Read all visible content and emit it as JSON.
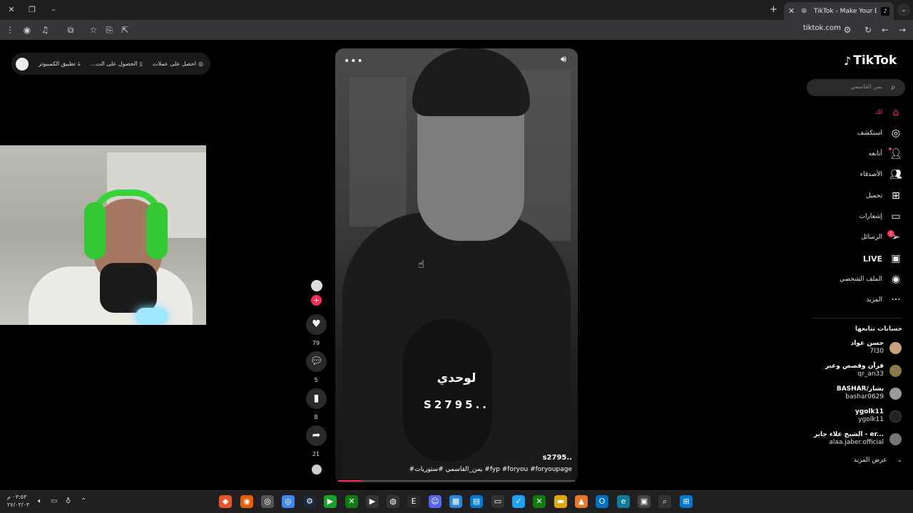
{
  "browser": {
    "tab_title": "TikTok - Make Your Day",
    "address": "tiktok.com"
  },
  "top_bar": {
    "get_coins": "احصل على عملات",
    "get_app": "الحصول على الت...",
    "desktop_app": "تطبيق الكمبيوتر"
  },
  "video": {
    "caption_line1": "لوحدي",
    "caption_line2": "S2795..",
    "author": "s2795..",
    "tags": "#يمن_القاسمي #ستوريات #fyp #foryou #foryoupage",
    "progress": 0.1
  },
  "actions": {
    "likes": "79",
    "comments": "5",
    "saves": "8",
    "shares": "21"
  },
  "sidebar": {
    "logo": "TikTok",
    "search_placeholder": "يمن القاسمي",
    "nav": [
      {
        "label": "لك",
        "icon": "home-icon"
      },
      {
        "label": "استكشف",
        "icon": "compass-icon"
      },
      {
        "label": "أتابعه",
        "icon": "following-icon"
      },
      {
        "label": "الأصدقاء",
        "icon": "friends-icon"
      },
      {
        "label": "تحميل",
        "icon": "upload-icon"
      },
      {
        "label": "إشعارات",
        "icon": "notification-icon"
      },
      {
        "label": "الرسائل",
        "icon": "message-icon"
      },
      {
        "label": "LIVE",
        "icon": "live-icon"
      },
      {
        "label": "الملف الشخصي",
        "icon": "profile-icon"
      },
      {
        "label": "المزيد",
        "icon": "more-icon"
      }
    ],
    "messages_badge": "1",
    "following_title": "حسابات تتابعها",
    "accounts": [
      {
        "name": "حسن عواد",
        "handle": "7l30",
        "color": "#c9a27a"
      },
      {
        "name": "قرآن وقصص وعبر",
        "handle": "qr_an33",
        "color": "#8a7a4a"
      },
      {
        "name": "BASHAR/بشار",
        "handle": "bashar0629",
        "color": "#9a9a9a"
      },
      {
        "name": "ygolk11",
        "handle": "ygolk11",
        "color": "#222222"
      },
      {
        "name": "الشيخ علاء جابر - er...",
        "handle": "alaa.jaber.official",
        "color": "#777777"
      }
    ],
    "see_more": "عرض المزيد"
  },
  "taskbar": {
    "time": "٠٣:٥٣ م",
    "date": "٢٧/٠٣/٠٣"
  },
  "colors": {
    "accent": "#fe2c55",
    "background": "#000000",
    "panel": "#2a2a2a"
  }
}
